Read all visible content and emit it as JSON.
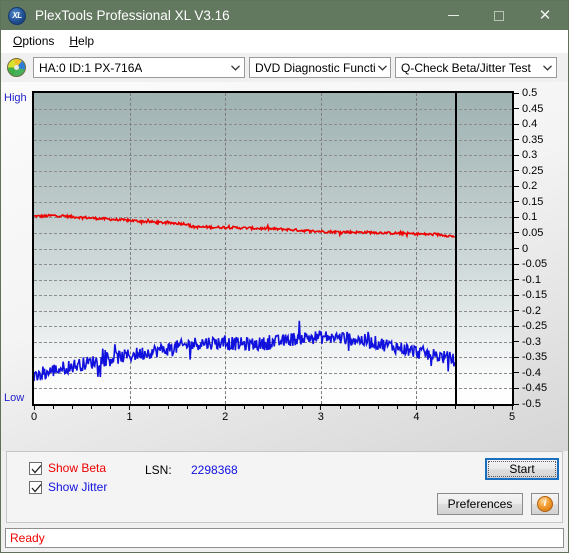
{
  "window": {
    "title": "PlexTools Professional XL V3.16",
    "icon": "xl-logo-icon",
    "minimize_label": "—",
    "maximize_label": "□",
    "close_label": "✕"
  },
  "menubar": {
    "items": [
      {
        "pre": "",
        "acc": "O",
        "post": "ptions"
      },
      {
        "pre": "",
        "acc": "H",
        "post": "elp"
      }
    ]
  },
  "toolbar": {
    "drive_icon": "optical-disc-icon",
    "drive": "HA:0 ID:1  PX-716A",
    "function": "DVD Diagnostic Functions",
    "test": "Q-Check Beta/Jitter Test"
  },
  "chart_labels": {
    "high": "High",
    "low": "Low"
  },
  "controls": {
    "show_beta": "Show Beta",
    "show_beta_acc": "B",
    "show_jitter": "Show Jitter",
    "show_jitter_acc": "J",
    "beta_checked": true,
    "jitter_checked": true,
    "lsn_label": "LSN:",
    "lsn_value": "2298368",
    "start_label": "Start",
    "start_acc": "S",
    "preferences_label": "Preferences",
    "preferences_acc": "P",
    "info_label": "i"
  },
  "status": {
    "text": "Ready"
  },
  "colors": {
    "titlebar": "#62785f",
    "beta": "#ee0000",
    "jitter": "#1111dd",
    "status": "#ee0000",
    "accent": "#1a6ec0"
  },
  "chart_data": {
    "type": "line",
    "title": "Q-Check Beta/Jitter Test",
    "xlabel": "",
    "ylabel": "",
    "xlim": [
      0,
      5
    ],
    "ylim": [
      -0.5,
      0.5
    ],
    "grid": true,
    "legend_position": "bottom-left",
    "xticks": [
      0,
      1,
      2,
      3,
      4,
      5
    ],
    "yticks": [
      0.5,
      0.45,
      0.4,
      0.35,
      0.3,
      0.25,
      0.2,
      0.15,
      0.1,
      0.05,
      0,
      -0.05,
      -0.1,
      -0.15,
      -0.2,
      -0.25,
      -0.3,
      -0.35,
      -0.4,
      -0.45,
      -0.5
    ],
    "ytick_labels": [
      "0.5",
      "0.45",
      "0.4",
      "0.35",
      "0.3",
      "0.25",
      "0.2",
      "0.15",
      "0.1",
      "0.05",
      "0",
      "-0.05",
      "-0.1",
      "-0.15",
      "-0.2",
      "-0.25",
      "-0.3",
      "-0.35",
      "-0.4",
      "-0.45",
      "-0.5"
    ],
    "data_end_x": 4.4,
    "series": [
      {
        "name": "Show Beta",
        "color": "#ee0000",
        "x": [
          0.0,
          0.1,
          0.2,
          0.3,
          0.4,
          0.5,
          0.6,
          0.7,
          0.8,
          0.9,
          1.0,
          1.1,
          1.2,
          1.3,
          1.4,
          1.5,
          1.6,
          1.65,
          1.7,
          1.8,
          1.9,
          2.0,
          2.1,
          2.2,
          2.3,
          2.4,
          2.5,
          2.6,
          2.7,
          2.8,
          2.9,
          3.0,
          3.1,
          3.2,
          3.3,
          3.4,
          3.5,
          3.6,
          3.7,
          3.8,
          3.9,
          4.0,
          4.1,
          4.2,
          4.3,
          4.4
        ],
        "y": [
          0.104,
          0.104,
          0.106,
          0.105,
          0.102,
          0.1,
          0.098,
          0.096,
          0.094,
          0.092,
          0.09,
          0.088,
          0.086,
          0.084,
          0.082,
          0.081,
          0.079,
          0.07,
          0.069,
          0.069,
          0.068,
          0.068,
          0.067,
          0.066,
          0.065,
          0.064,
          0.063,
          0.062,
          0.06,
          0.058,
          0.056,
          0.055,
          0.054,
          0.053,
          0.053,
          0.052,
          0.052,
          0.051,
          0.05,
          0.049,
          0.048,
          0.047,
          0.046,
          0.045,
          0.043,
          0.038
        ],
        "noise": 0.004
      },
      {
        "name": "Show Jitter",
        "color": "#1111dd",
        "x": [
          0.0,
          0.1,
          0.2,
          0.3,
          0.4,
          0.5,
          0.6,
          0.7,
          0.8,
          0.9,
          1.0,
          1.1,
          1.2,
          1.3,
          1.4,
          1.5,
          1.6,
          1.7,
          1.8,
          1.9,
          2.0,
          2.1,
          2.2,
          2.3,
          2.4,
          2.5,
          2.6,
          2.7,
          2.8,
          2.9,
          3.0,
          3.1,
          3.2,
          3.3,
          3.4,
          3.5,
          3.6,
          3.7,
          3.8,
          3.9,
          4.0,
          4.1,
          4.2,
          4.3,
          4.4
        ],
        "y": [
          -0.42,
          -0.404,
          -0.392,
          -0.384,
          -0.378,
          -0.372,
          -0.366,
          -0.36,
          -0.354,
          -0.349,
          -0.344,
          -0.338,
          -0.333,
          -0.328,
          -0.323,
          -0.317,
          -0.31,
          -0.305,
          -0.303,
          -0.303,
          -0.304,
          -0.306,
          -0.308,
          -0.308,
          -0.306,
          -0.302,
          -0.298,
          -0.292,
          -0.288,
          -0.286,
          -0.285,
          -0.285,
          -0.287,
          -0.29,
          -0.294,
          -0.299,
          -0.305,
          -0.311,
          -0.318,
          -0.325,
          -0.332,
          -0.338,
          -0.344,
          -0.35,
          -0.358
        ],
        "noise": 0.022
      }
    ]
  }
}
